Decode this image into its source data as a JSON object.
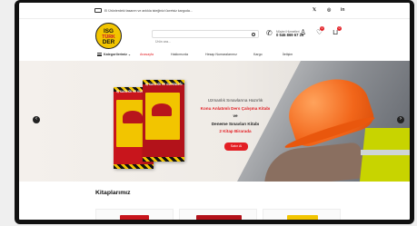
{
  "topbar": {
    "notice": "El Ürünlerdeki tasarım ve anlıkla isteğinizi ücretsiz kargoda...",
    "social": [
      "𝕏",
      "◎",
      "in"
    ]
  },
  "header": {
    "logo_line1": "ISG",
    "logo_line2": "TÜRK",
    "logo_line3": "DER",
    "search_placeholder": "Ürün ara...",
    "phone_label": "Müşteri Hizmetleri",
    "phone_number": "0 546 869 67 26",
    "cart_count": "0",
    "wishlist_count": "0"
  },
  "nav": {
    "categories": "Kategorilerimiz ⌄",
    "items": [
      "Anasayfa",
      "Hakkımızda",
      "Hesap Numaralarımız",
      "Kargo",
      "İletişim"
    ]
  },
  "hero": {
    "line1": "Uzmanlık Sınavlarına Hazırlık",
    "line2": "Konu Anlatımlı Ders Çalışma Kitabı",
    "line3": "ve",
    "line4": "Deneme Sınavları Kitabı",
    "line5": "2 Kitap Birarada",
    "cta": "Satın Al",
    "book1_title": "İŞ SAĞLIĞI VE GÜVENLİĞİ",
    "book2_title": "İŞ SAĞLIĞI VE GÜVENLİĞİ"
  },
  "section": {
    "title": "Kitaplarımız"
  },
  "colors": {
    "accent": "#e31e24",
    "logo_yellow": "#f2c500"
  },
  "icons": {
    "truck": "truck-icon",
    "search": "search-icon",
    "phone": "phone-icon",
    "user": "user-icon",
    "heart": "heart-icon",
    "cart": "cart-icon"
  }
}
